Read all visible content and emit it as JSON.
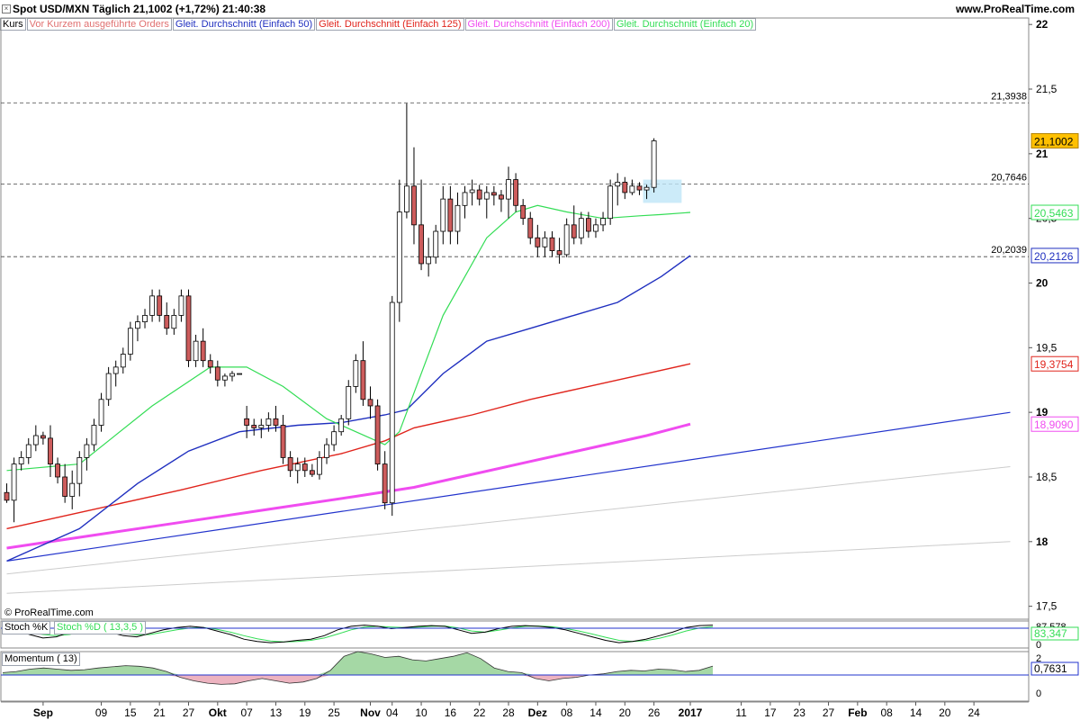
{
  "header": {
    "title": "Spot USD/MXN   Täglich   21,1002 (+1,72%)   21:40:38",
    "site": "www.ProRealTime.com",
    "watermark": "© ProRealTime.com"
  },
  "legend": [
    {
      "label": "Kurs",
      "color": "#000000"
    },
    {
      "label": "Vor Kurzem ausgeführte Orders",
      "color": "#e07070"
    },
    {
      "label": "Gleit. Durchschnitt (Einfach 50)",
      "color": "#1f2fbf"
    },
    {
      "label": "Gleit. Durchschnitt (Einfach 125)",
      "color": "#e0241c"
    },
    {
      "label": "Gleit. Durchschnitt (Einfach 200)",
      "color": "#f04cf0"
    },
    {
      "label": "Gleit. Durchschnitt (Einfach 20)",
      "color": "#33dd55"
    }
  ],
  "panes": {
    "stoch_label": "Stoch %K",
    "stoch_d_label": "Stoch %D ( 13,3,5 )",
    "stoch_value": "83,347",
    "stoch_top_tick": "87,578",
    "stoch_tick_0": "0",
    "momentum_label": "Momentum ( 13)",
    "momentum_value": "0,7631",
    "momentum_tick_2": "2",
    "momentum_tick_0": "0"
  },
  "colors": {
    "up_body": "#ffffff",
    "down_body": "#cd5c5c",
    "ma20": "#33dd55",
    "ma50": "#1f2fbf",
    "ma125": "#e0241c",
    "ma200": "#f04cf0",
    "trend_blue": "#2233cc",
    "trend_gray": "#cccccc",
    "current_tag": "#ffc000",
    "highlight": "#bfe6f7"
  },
  "chart_data": {
    "type": "candlestick",
    "y_ticks": [
      "22",
      "21,5",
      "21",
      "20,5",
      "20",
      "19,5",
      "19",
      "18,5",
      "18",
      "17,5"
    ],
    "y_tick_values": [
      22,
      21.5,
      21,
      20.5,
      20,
      19.5,
      19,
      18.5,
      18,
      17.5
    ],
    "ylim": [
      17.4,
      22.05
    ],
    "x_labels": [
      {
        "text": "Sep",
        "bold": true,
        "idx": 5
      },
      {
        "text": "09",
        "bold": false,
        "idx": 13
      },
      {
        "text": "15",
        "bold": false,
        "idx": 17
      },
      {
        "text": "21",
        "bold": false,
        "idx": 21
      },
      {
        "text": "27",
        "bold": false,
        "idx": 25
      },
      {
        "text": "Okt",
        "bold": true,
        "idx": 29
      },
      {
        "text": "07",
        "bold": false,
        "idx": 33
      },
      {
        "text": "13",
        "bold": false,
        "idx": 37
      },
      {
        "text": "19",
        "bold": false,
        "idx": 41
      },
      {
        "text": "25",
        "bold": false,
        "idx": 45
      },
      {
        "text": "Nov",
        "bold": true,
        "idx": 50
      },
      {
        "text": "04",
        "bold": false,
        "idx": 53
      },
      {
        "text": "10",
        "bold": false,
        "idx": 57
      },
      {
        "text": "16",
        "bold": false,
        "idx": 61
      },
      {
        "text": "22",
        "bold": false,
        "idx": 65
      },
      {
        "text": "28",
        "bold": false,
        "idx": 69
      },
      {
        "text": "Dez",
        "bold": true,
        "idx": 73
      },
      {
        "text": "08",
        "bold": false,
        "idx": 77
      },
      {
        "text": "14",
        "bold": false,
        "idx": 81
      },
      {
        "text": "20",
        "bold": false,
        "idx": 85
      },
      {
        "text": "26",
        "bold": false,
        "idx": 89
      },
      {
        "text": "2017",
        "bold": true,
        "idx": 94
      },
      {
        "text": "11",
        "bold": false,
        "idx": 101
      },
      {
        "text": "17",
        "bold": false,
        "idx": 105
      },
      {
        "text": "23",
        "bold": false,
        "idx": 109
      },
      {
        "text": "27",
        "bold": false,
        "idx": 113
      },
      {
        "text": "Feb",
        "bold": true,
        "idx": 117
      },
      {
        "text": "08",
        "bold": false,
        "idx": 121
      },
      {
        "text": "14",
        "bold": false,
        "idx": 125
      },
      {
        "text": "20",
        "bold": false,
        "idx": 129
      },
      {
        "text": "24",
        "bold": false,
        "idx": 133
      }
    ],
    "levels": [
      {
        "label": "21,3938",
        "value": 21.3938
      },
      {
        "label": "20,7646",
        "value": 20.7646
      },
      {
        "label": "20,2039",
        "value": 20.2039
      }
    ],
    "current_price": {
      "label": "21,1002",
      "value": 21.1002
    },
    "ma_tags": [
      {
        "label": "20,5463",
        "value": 20.5463,
        "series": "ma20"
      },
      {
        "label": "20,2126",
        "value": 20.2126,
        "series": "ma50"
      },
      {
        "label": "19,3754",
        "value": 19.3754,
        "series": "ma125"
      },
      {
        "label": "18,9090",
        "value": 18.909,
        "series": "ma200"
      }
    ],
    "candles": [
      [
        18.38,
        18.45,
        18.3,
        18.32
      ],
      [
        18.32,
        18.65,
        18.15,
        18.6
      ],
      [
        18.6,
        18.7,
        18.55,
        18.65
      ],
      [
        18.65,
        18.8,
        18.6,
        18.75
      ],
      [
        18.75,
        18.9,
        18.7,
        18.82
      ],
      [
        18.82,
        18.85,
        18.75,
        18.8
      ],
      [
        18.8,
        18.9,
        18.5,
        18.6
      ],
      [
        18.6,
        18.65,
        18.45,
        18.5
      ],
      [
        18.5,
        18.6,
        18.3,
        18.35
      ],
      [
        18.35,
        18.55,
        18.25,
        18.45
      ],
      [
        18.45,
        18.7,
        18.35,
        18.65
      ],
      [
        18.65,
        18.8,
        18.55,
        18.75
      ],
      [
        18.75,
        18.95,
        18.7,
        18.9
      ],
      [
        18.9,
        19.15,
        18.85,
        19.1
      ],
      [
        19.1,
        19.35,
        19.05,
        19.3
      ],
      [
        19.3,
        19.4,
        19.2,
        19.35
      ],
      [
        19.35,
        19.5,
        19.3,
        19.45
      ],
      [
        19.45,
        19.7,
        19.4,
        19.65
      ],
      [
        19.65,
        19.75,
        19.55,
        19.7
      ],
      [
        19.7,
        19.8,
        19.65,
        19.75
      ],
      [
        19.75,
        19.95,
        19.7,
        19.9
      ],
      [
        19.9,
        19.95,
        19.7,
        19.75
      ],
      [
        19.75,
        19.85,
        19.6,
        19.65
      ],
      [
        19.65,
        19.8,
        19.6,
        19.75
      ],
      [
        19.75,
        19.95,
        19.7,
        19.9
      ],
      [
        19.9,
        19.95,
        19.35,
        19.4
      ],
      [
        19.4,
        19.6,
        19.35,
        19.55
      ],
      [
        19.55,
        19.65,
        19.35,
        19.4
      ],
      [
        19.4,
        19.45,
        19.3,
        19.35
      ],
      [
        19.35,
        19.4,
        19.2,
        19.25
      ],
      [
        19.25,
        19.3,
        19.2,
        19.28
      ],
      [
        19.28,
        19.32,
        19.24,
        19.3
      ],
      [
        19.3,
        19.3,
        19.3,
        19.3
      ],
      [
        18.95,
        19.05,
        18.8,
        18.9
      ],
      [
        18.9,
        18.95,
        18.82,
        18.88
      ],
      [
        18.88,
        18.95,
        18.8,
        18.9
      ],
      [
        18.9,
        19.0,
        18.85,
        18.95
      ],
      [
        18.95,
        19.05,
        18.85,
        18.9
      ],
      [
        18.9,
        18.98,
        18.6,
        18.65
      ],
      [
        18.65,
        18.7,
        18.5,
        18.55
      ],
      [
        18.55,
        18.65,
        18.45,
        18.6
      ],
      [
        18.6,
        18.65,
        18.5,
        18.55
      ],
      [
        18.55,
        18.6,
        18.5,
        18.52
      ],
      [
        18.52,
        18.7,
        18.48,
        18.65
      ],
      [
        18.65,
        18.8,
        18.6,
        18.75
      ],
      [
        18.75,
        18.9,
        18.7,
        18.85
      ],
      [
        18.85,
        18.98,
        18.82,
        18.95
      ],
      [
        18.95,
        19.25,
        18.9,
        19.2
      ],
      [
        19.2,
        19.45,
        19.15,
        19.4
      ],
      [
        19.4,
        19.55,
        19.05,
        19.1
      ],
      [
        19.1,
        19.2,
        18.95,
        19.05
      ],
      [
        19.05,
        19.1,
        18.55,
        18.6
      ],
      [
        18.6,
        18.7,
        18.25,
        18.3
      ],
      [
        18.3,
        19.9,
        18.2,
        19.85
      ],
      [
        19.85,
        20.8,
        19.7,
        20.55
      ],
      [
        20.55,
        21.39,
        20.5,
        20.75
      ],
      [
        20.75,
        21.05,
        20.3,
        20.45
      ],
      [
        20.45,
        20.8,
        20.1,
        20.15
      ],
      [
        20.15,
        20.35,
        20.05,
        20.2
      ],
      [
        20.2,
        20.45,
        20.15,
        20.4
      ],
      [
        20.4,
        20.75,
        20.3,
        20.65
      ],
      [
        20.65,
        20.75,
        20.3,
        20.4
      ],
      [
        20.4,
        20.7,
        20.3,
        20.6
      ],
      [
        20.6,
        20.75,
        20.5,
        20.7
      ],
      [
        20.7,
        20.8,
        20.6,
        20.72
      ],
      [
        20.72,
        20.76,
        20.6,
        20.65
      ],
      [
        20.65,
        20.75,
        20.5,
        20.7
      ],
      [
        20.7,
        20.75,
        20.6,
        20.68
      ],
      [
        20.68,
        20.72,
        20.55,
        20.65
      ],
      [
        20.65,
        20.9,
        20.5,
        20.8
      ],
      [
        20.8,
        20.85,
        20.55,
        20.6
      ],
      [
        20.6,
        20.65,
        20.45,
        20.5
      ],
      [
        20.5,
        20.55,
        20.3,
        20.35
      ],
      [
        20.35,
        20.45,
        20.2,
        20.28
      ],
      [
        20.28,
        20.4,
        20.2,
        20.35
      ],
      [
        20.35,
        20.4,
        20.2,
        20.25
      ],
      [
        20.25,
        20.35,
        20.15,
        20.22
      ],
      [
        20.22,
        20.5,
        20.2,
        20.45
      ],
      [
        20.45,
        20.6,
        20.3,
        20.35
      ],
      [
        20.35,
        20.55,
        20.3,
        20.5
      ],
      [
        20.5,
        20.55,
        20.35,
        20.4
      ],
      [
        20.4,
        20.5,
        20.35,
        20.45
      ],
      [
        20.45,
        20.55,
        20.4,
        20.5
      ],
      [
        20.5,
        20.8,
        20.45,
        20.75
      ],
      [
        20.75,
        20.85,
        20.6,
        20.78
      ],
      [
        20.78,
        20.82,
        20.65,
        20.7
      ],
      [
        20.7,
        20.8,
        20.68,
        20.75
      ],
      [
        20.75,
        20.78,
        20.68,
        20.72
      ],
      [
        20.72,
        20.76,
        20.65,
        20.74
      ],
      [
        20.74,
        21.12,
        20.7,
        21.1
      ]
    ],
    "ma20": [
      [
        0,
        18.55
      ],
      [
        10,
        18.6
      ],
      [
        20,
        19.05
      ],
      [
        28,
        19.35
      ],
      [
        33,
        19.35
      ],
      [
        38,
        19.2
      ],
      [
        44,
        18.95
      ],
      [
        48,
        18.85
      ],
      [
        52,
        18.75
      ],
      [
        54,
        18.85
      ],
      [
        56,
        19.15
      ],
      [
        60,
        19.75
      ],
      [
        66,
        20.35
      ],
      [
        70,
        20.55
      ],
      [
        73,
        20.6
      ],
      [
        77,
        20.55
      ],
      [
        82,
        20.5
      ],
      [
        87,
        20.52
      ],
      [
        90,
        20.53
      ],
      [
        94,
        20.5463
      ]
    ],
    "ma50": [
      [
        0,
        17.85
      ],
      [
        10,
        18.1
      ],
      [
        18,
        18.45
      ],
      [
        25,
        18.7
      ],
      [
        32,
        18.85
      ],
      [
        40,
        18.9
      ],
      [
        46,
        18.92
      ],
      [
        52,
        18.98
      ],
      [
        55,
        19.02
      ],
      [
        60,
        19.3
      ],
      [
        66,
        19.55
      ],
      [
        72,
        19.65
      ],
      [
        78,
        19.75
      ],
      [
        84,
        19.85
      ],
      [
        90,
        20.05
      ],
      [
        94,
        20.2126
      ]
    ],
    "ma125": [
      [
        0,
        18.1
      ],
      [
        12,
        18.25
      ],
      [
        24,
        18.4
      ],
      [
        35,
        18.55
      ],
      [
        46,
        18.68
      ],
      [
        52,
        18.78
      ],
      [
        56,
        18.88
      ],
      [
        64,
        18.98
      ],
      [
        72,
        19.1
      ],
      [
        80,
        19.2
      ],
      [
        88,
        19.3
      ],
      [
        94,
        19.3754
      ]
    ],
    "ma200": [
      [
        0,
        17.95
      ],
      [
        12,
        18.05
      ],
      [
        24,
        18.15
      ],
      [
        36,
        18.25
      ],
      [
        48,
        18.35
      ],
      [
        56,
        18.42
      ],
      [
        64,
        18.52
      ],
      [
        72,
        18.62
      ],
      [
        80,
        18.72
      ],
      [
        88,
        18.82
      ],
      [
        94,
        18.909
      ]
    ],
    "trend_blue": [
      [
        0,
        17.85
      ],
      [
        138,
        19.0
      ]
    ],
    "trend_gray_1": [
      [
        0,
        17.75
      ],
      [
        138,
        18.58
      ]
    ],
    "trend_gray_2": [
      [
        0,
        17.6
      ],
      [
        138,
        18.0
      ]
    ]
  }
}
